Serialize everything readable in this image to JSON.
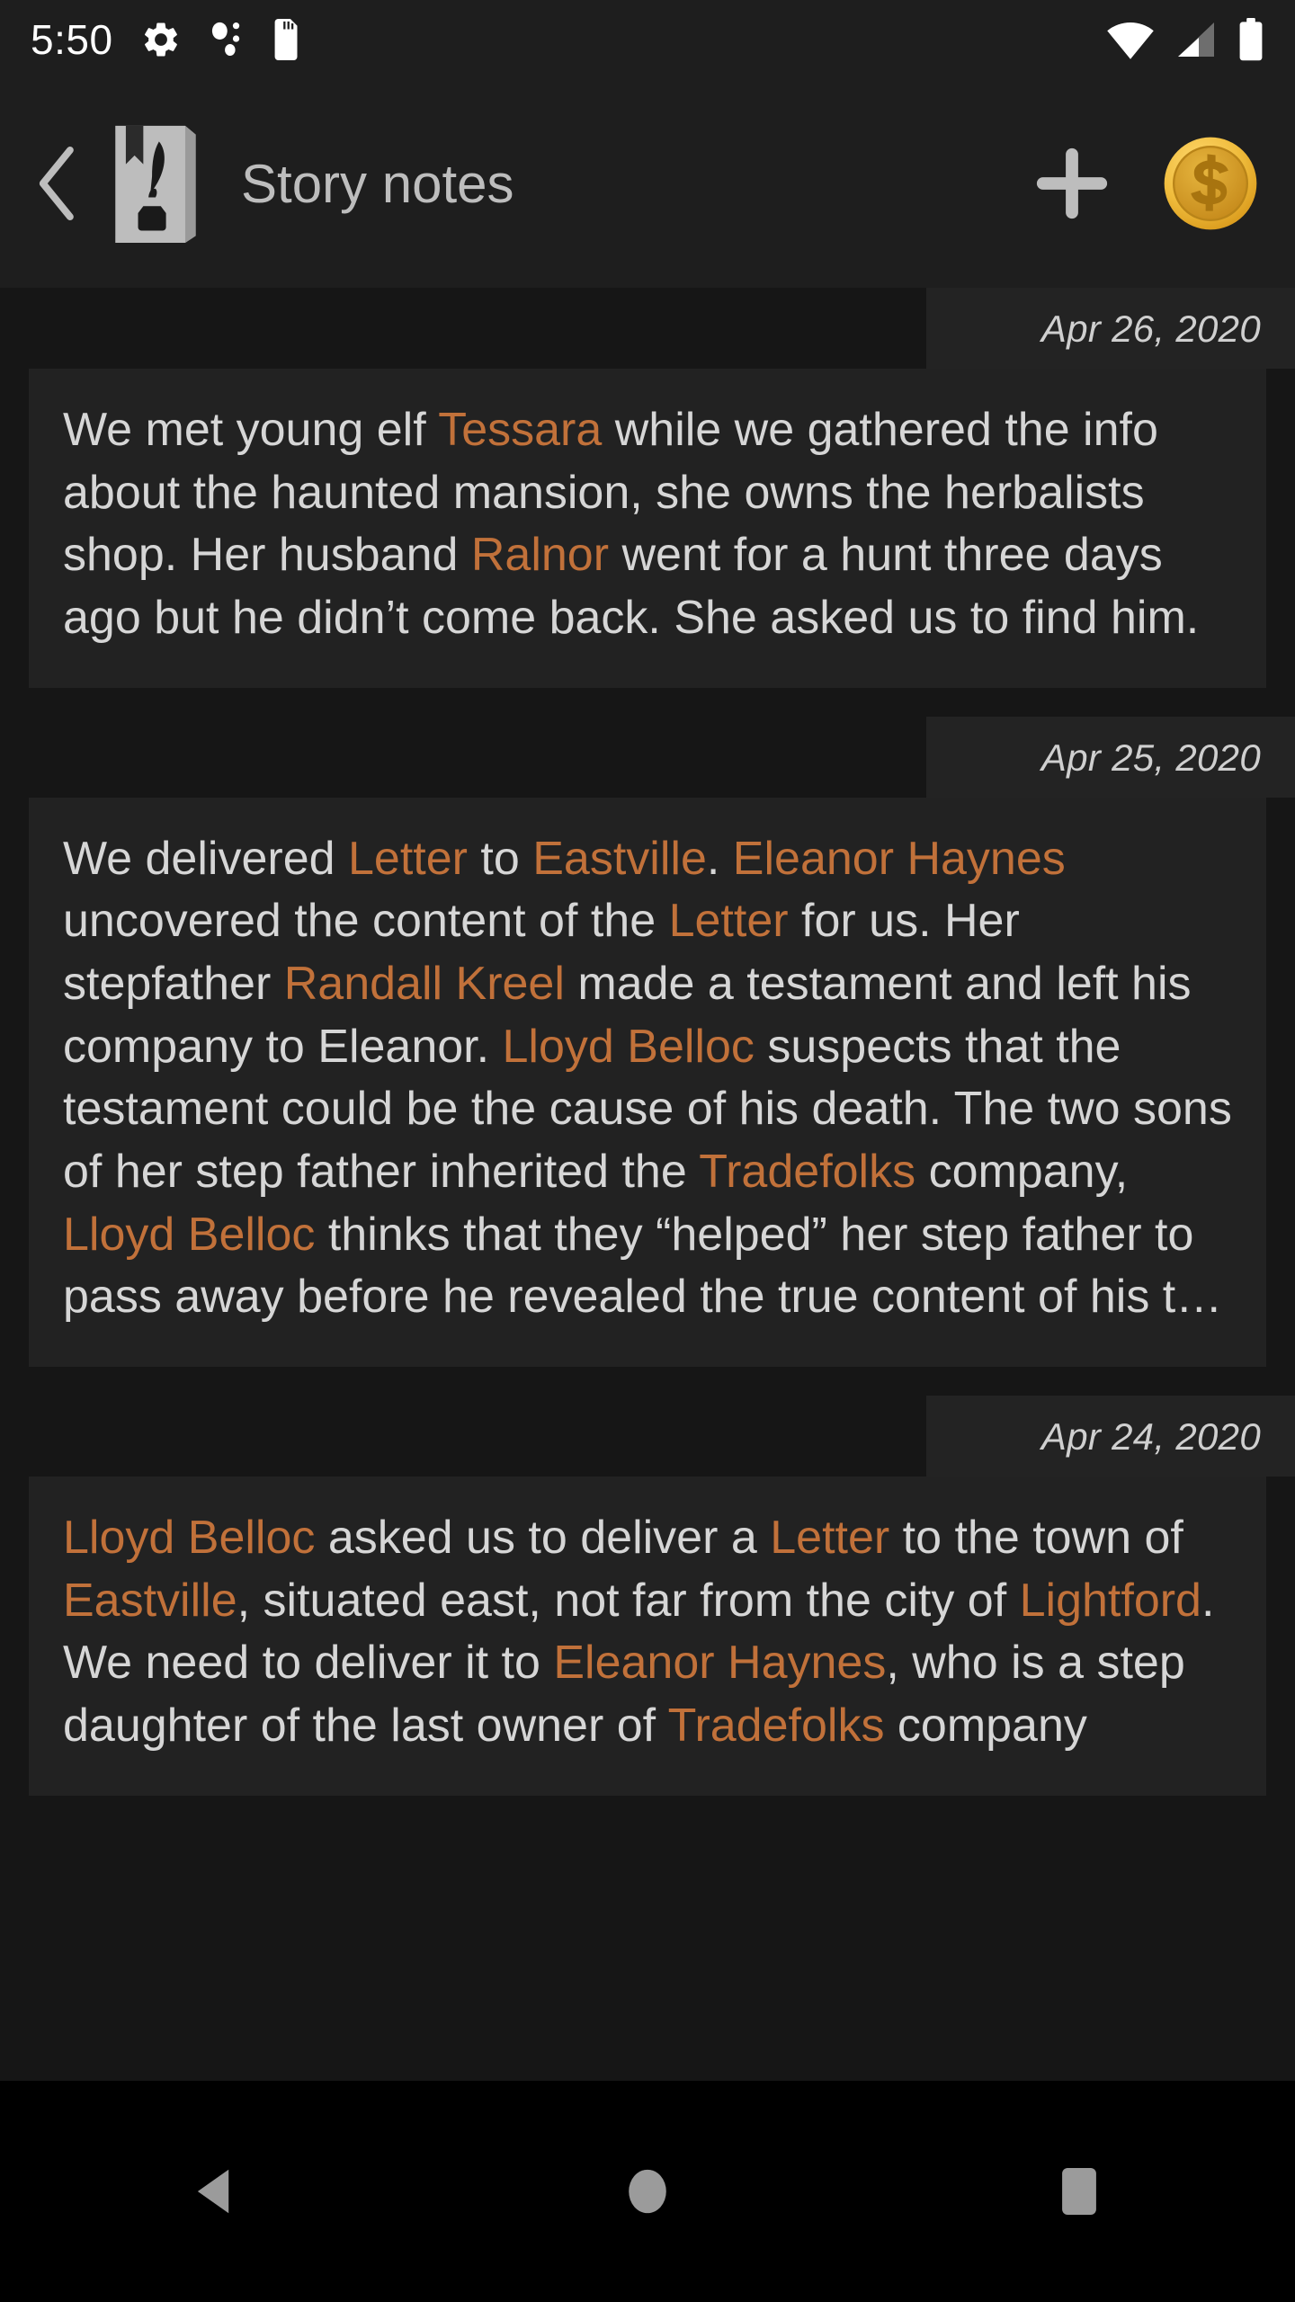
{
  "status_bar": {
    "clock": "5:50",
    "icons": [
      {
        "name": "settings-gear-icon"
      },
      {
        "name": "bluetooth-dots-icon"
      },
      {
        "name": "sd-card-icon"
      }
    ],
    "right_icons": [
      {
        "name": "wifi-icon"
      },
      {
        "name": "cell-signal-icon"
      },
      {
        "name": "battery-full-icon"
      }
    ]
  },
  "toolbar": {
    "back_label": "‹",
    "app_icon_name": "book-quill-icon",
    "title": "Story notes",
    "add_label": "+",
    "currency_label": "$",
    "accent_color": "#c1713a",
    "coin_color": "#e8b128"
  },
  "notes": [
    {
      "date": "Apr 26, 2020",
      "segments": [
        {
          "text": "We met young elf ",
          "entity": false
        },
        {
          "text": "Tessara",
          "entity": true
        },
        {
          "text": " while we gathered the info about the haunted mansion, she owns the herbalists shop. Her husband ",
          "entity": false
        },
        {
          "text": "Ralnor",
          "entity": true
        },
        {
          "text": " went for a hunt three days ago but he didn’t come back. She asked us to find him.",
          "entity": false
        }
      ]
    },
    {
      "date": "Apr 25, 2020",
      "segments": [
        {
          "text": "We delivered ",
          "entity": false
        },
        {
          "text": "Letter",
          "entity": true
        },
        {
          "text": " to ",
          "entity": false
        },
        {
          "text": "Eastville",
          "entity": true
        },
        {
          "text": ". ",
          "entity": false
        },
        {
          "text": "Eleanor Haynes",
          "entity": true
        },
        {
          "text": " uncovered the content of the ",
          "entity": false
        },
        {
          "text": "Letter",
          "entity": true
        },
        {
          "text": " for us. Her stepfather ",
          "entity": false
        },
        {
          "text": "Randall Kreel",
          "entity": true
        },
        {
          "text": " made a testament and left his company to Eleanor. ",
          "entity": false
        },
        {
          "text": "Lloyd Belloc",
          "entity": true
        },
        {
          "text": " suspects that the testament could be the cause of his death. The two sons of her step father inherited the ",
          "entity": false
        },
        {
          "text": "Tradefolks",
          "entity": true
        },
        {
          "text": " company, ",
          "entity": false
        },
        {
          "text": "Lloyd Belloc",
          "entity": true
        },
        {
          "text": " thinks that they “helped” her step father to pass away before he revealed the true content of his t…",
          "entity": false
        }
      ]
    },
    {
      "date": "Apr 24, 2020",
      "segments": [
        {
          "text": "Lloyd Belloc",
          "entity": true
        },
        {
          "text": " asked us to deliver a ",
          "entity": false
        },
        {
          "text": "Letter",
          "entity": true
        },
        {
          "text": " to the town of ",
          "entity": false
        },
        {
          "text": "Eastville",
          "entity": true
        },
        {
          "text": ", situated east, not far from the city of ",
          "entity": false
        },
        {
          "text": "Lightford",
          "entity": true
        },
        {
          "text": ". We need to deliver it to ",
          "entity": false
        },
        {
          "text": "Eleanor Haynes",
          "entity": true
        },
        {
          "text": ", who is a step daughter of the last owner of ",
          "entity": false
        },
        {
          "text": "Tradefolks",
          "entity": true
        },
        {
          "text": " company",
          "entity": false
        }
      ]
    }
  ],
  "nav_bar": {
    "back_name": "nav-back-icon",
    "home_name": "nav-home-icon",
    "recents_name": "nav-recents-icon"
  }
}
